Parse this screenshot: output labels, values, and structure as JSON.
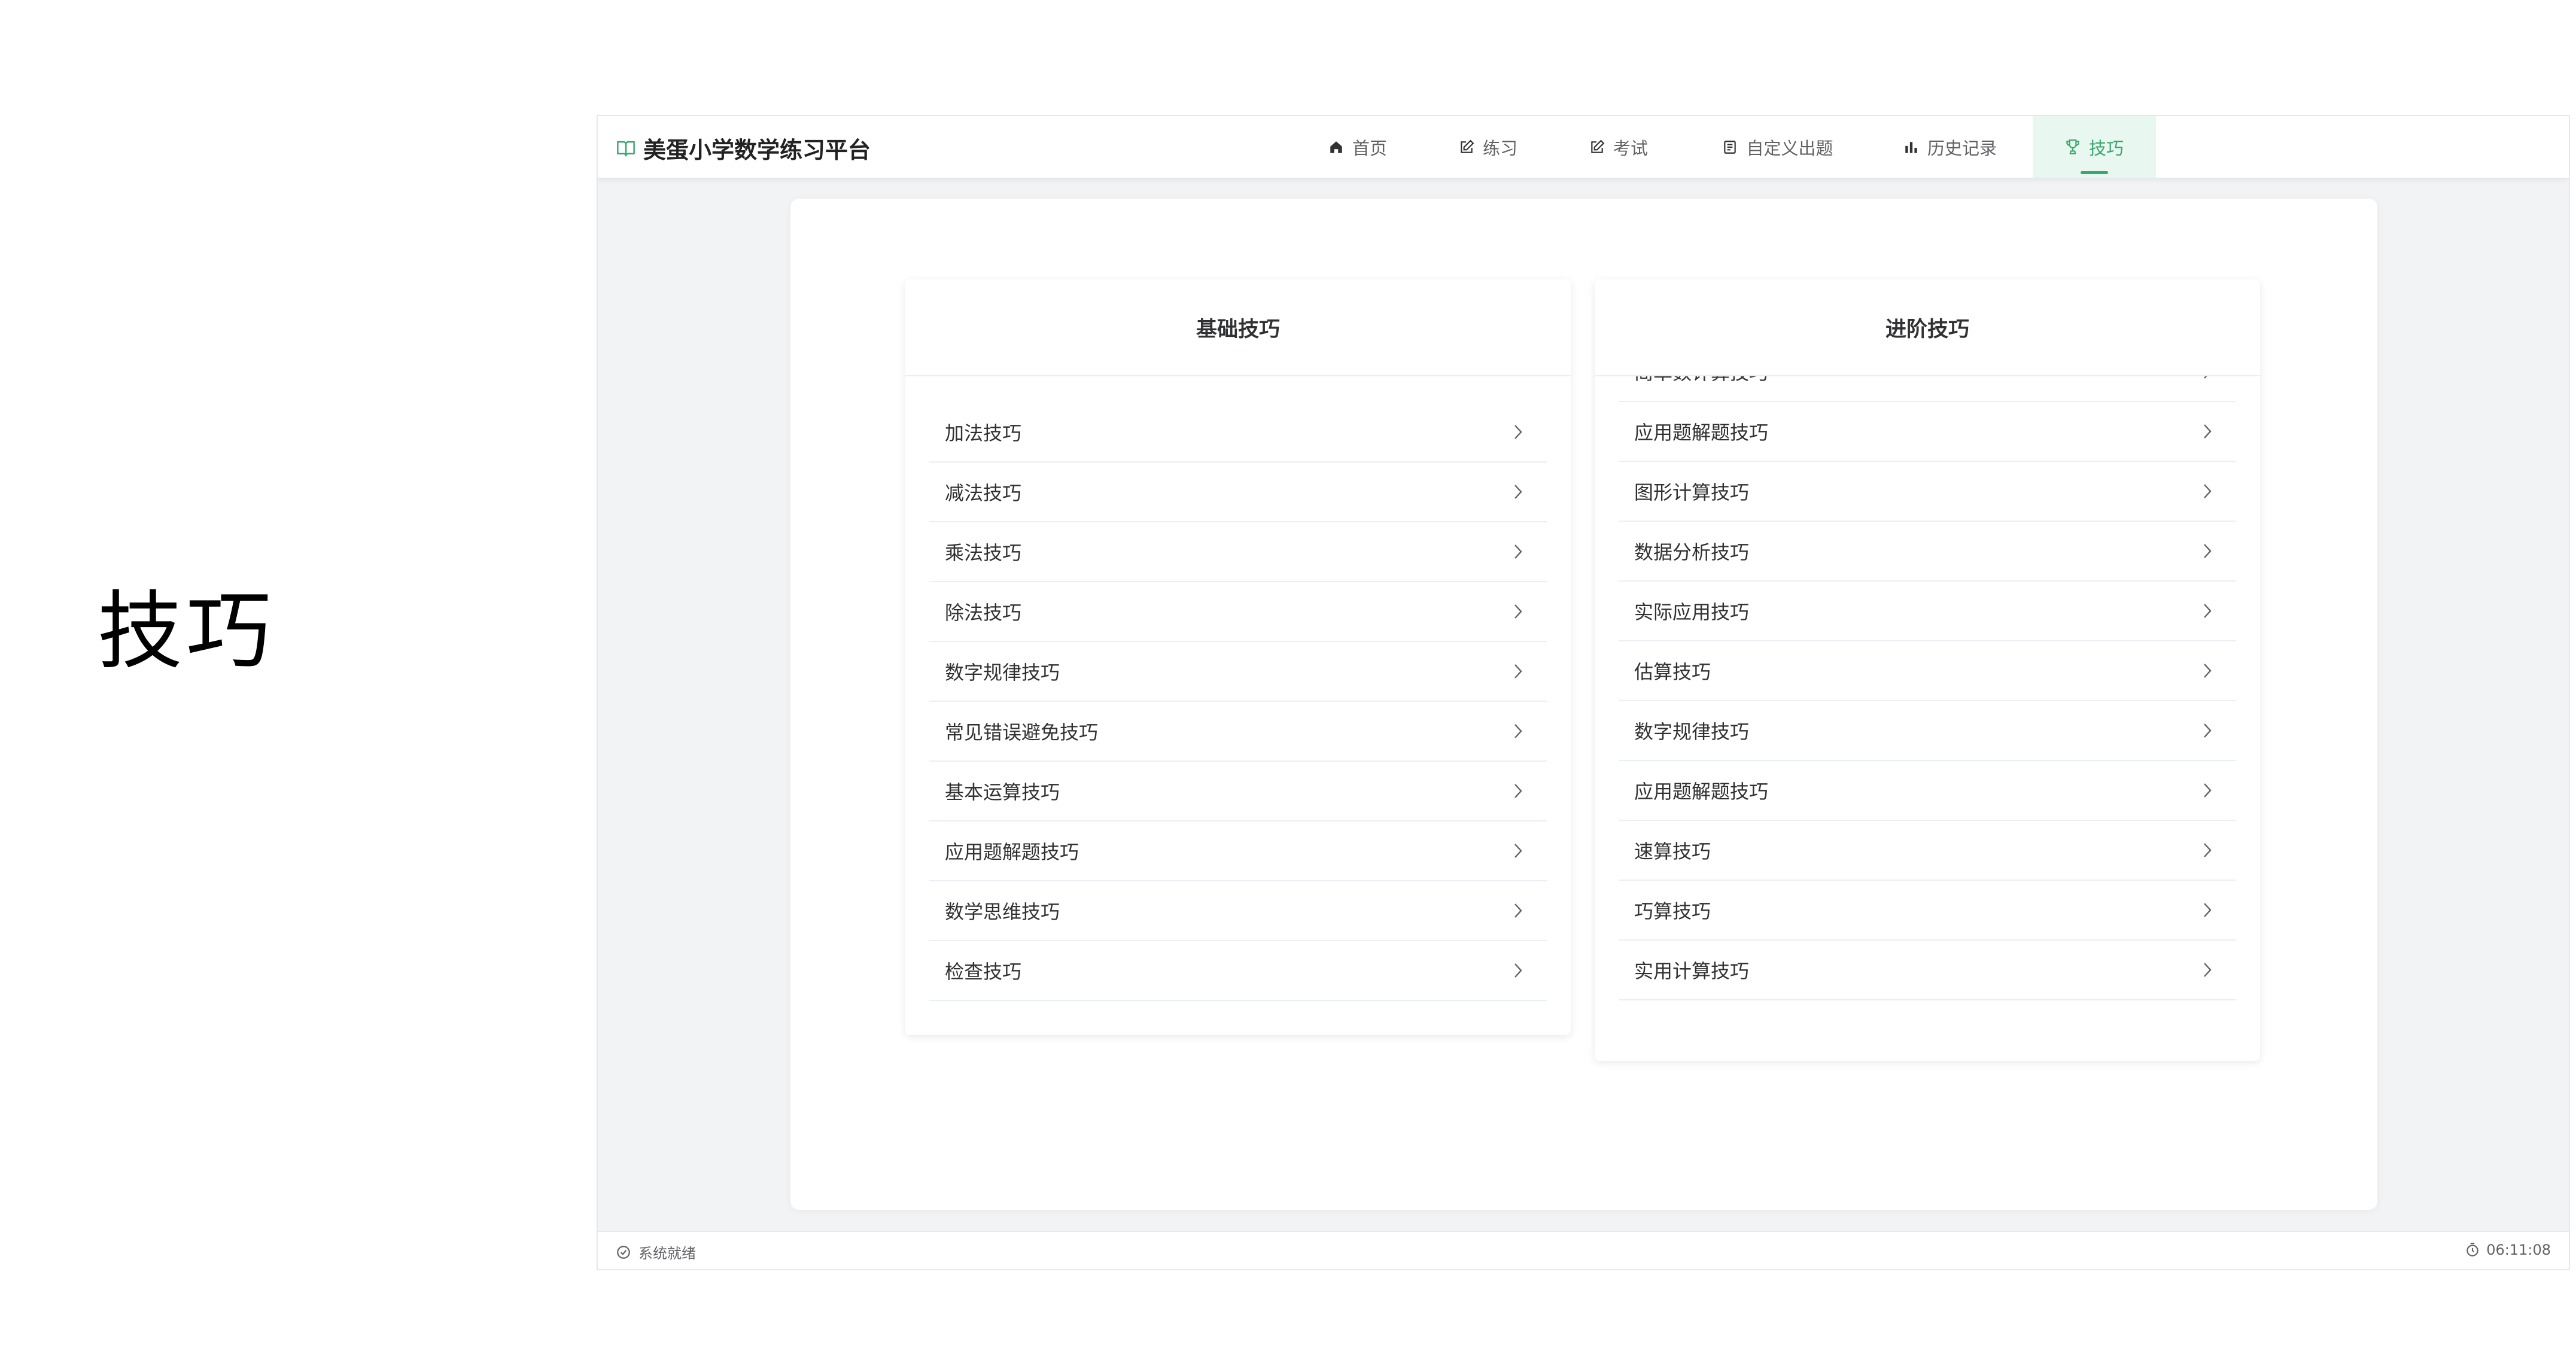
{
  "slide": {
    "title": "技巧"
  },
  "app": {
    "brand": {
      "title": "美蛋小学数学练习平台",
      "icon": "book-open-icon"
    },
    "nav": [
      {
        "label": "首页",
        "icon": "home-icon",
        "active": false
      },
      {
        "label": "练习",
        "icon": "edit-icon",
        "active": false
      },
      {
        "label": "考试",
        "icon": "edit-icon",
        "active": false
      },
      {
        "label": "自定义出题",
        "icon": "document-icon",
        "active": false
      },
      {
        "label": "历史记录",
        "icon": "bar-chart-icon",
        "active": false
      },
      {
        "label": "技巧",
        "icon": "trophy-icon",
        "active": true
      }
    ],
    "accent_color": "#3aa76d",
    "active_tab_bg": "#e8f7ef",
    "basic": {
      "title": "基础技巧",
      "items": [
        "加法技巧",
        "减法技巧",
        "乘法技巧",
        "除法技巧",
        "数字规律技巧",
        "常见错误避免技巧",
        "基本运算技巧",
        "应用题解题技巧",
        "数学思维技巧",
        "检查技巧"
      ]
    },
    "advanced": {
      "title": "进阶技巧",
      "items": [
        "简单数计算技巧",
        "应用题解题技巧",
        "图形计算技巧",
        "数据分析技巧",
        "实际应用技巧",
        "估算技巧",
        "数字规律技巧",
        "应用题解题技巧",
        "速算技巧",
        "巧算技巧",
        "实用计算技巧"
      ]
    },
    "status": {
      "text": "系统就绪",
      "time": "06:11:08",
      "left_icon": "check-circle-icon",
      "right_icon": "stopwatch-icon"
    }
  }
}
